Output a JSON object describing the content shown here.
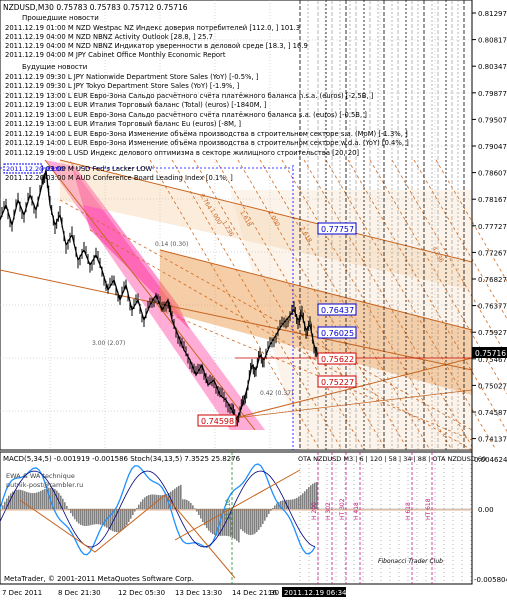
{
  "chart_header": "NZDUSD,M30  0.75783 0.75783 0.75712 0.75716",
  "news_past_title": "Прошедшие новости",
  "news_future_title": "Будущие новости",
  "news": [
    "2011.12.19 01:00 M NZD Westpac NZ Индекс доверия потребителей [112.0, ] 101.3",
    "2011.12.19 04:00 M NZD NBNZ Activity Outlook [28.8, ] 25.7",
    "2011.12.19 04:00 M NZD NBNZ Индикатор уверенности в деловой среде [18.3, ] 16.9",
    "2011.12.19 04:00 M JPY Cabinet Office Monthly Economic Report",
    "2011.12.19 09:30 L JPY Nationwide Department Store Sales (YoY) [-0.5%, ]",
    "2011.12.19 09:30 L JPY Tokyo Department Store Sales (YoY) [-1.9%, ]",
    "2011.12.19 13:00 L EUR Евро-Зона Сальдо расчётного счёта платёжного баланса n.s.a. (euros) [-2.5B, ]",
    "2011.12.19 13:00 L EUR Италия Торговый баланс (Total) (euros) [-1840M, ]",
    "2011.12.19 13:00 L EUR Евро-Зона Сальдо расчётного счёта платёжного баланса s.a. (euros) [-0.5B, ]",
    "2011.12.19 13:00 L EUR Италия Торговый баланс Eu (euros) [-8M, ]",
    "2011.12.19 14:00 L EUR Евро-Зона Изменение объёма производства в строительном секторе s.a. (MoM) [-1.3%, ]",
    "2011.12.19 14:00 L EUR Евро-Зона Изменение объёма производства в строительном секторе w.d.a. (YoY) [0.4%, ]",
    "2011.12.19 19:00 L USD Индекс делового оптимизма в секторе жилищного строительства [20, 20]",
    "2011.12.20 03:00 M USD Fed's Lacker LOW",
    "2011.12.20 03:00 M AUD Conference Board Leading Index [0.1%, ]"
  ],
  "news_time_box": "2011.12.20 03:00",
  "price_axis": [
    "0.81297",
    "0.80817",
    "0.80347",
    "0.79877",
    "0.79507",
    "0.79047",
    "0.78607",
    "0.78167",
    "0.77727",
    "0.77267",
    "0.76827",
    "0.76377",
    "0.75927",
    "0.75467",
    "0.75027",
    "0.74587",
    "0.74137"
  ],
  "price_labels": {
    "p1": "0.77757",
    "p2": "0.76437",
    "p3": "0.76025",
    "p4": "0.75622",
    "p5": "0.75227",
    "p6": "0.74598",
    "current": "0.75716"
  },
  "fib_labels": [
    {
      "text": "0.14 (0.30)"
    },
    {
      "text": "3.00 (2.07)"
    },
    {
      "text": "0.42 (0.37)"
    }
  ],
  "fan_labels": [
    "1.618",
    "2.000",
    "2.618",
    "4.236",
    "0.764",
    "1.000",
    "1.236"
  ],
  "indicator_header": "MACD(5,34,5) -0.001919 -0.001586  Stoch(34,13,5) 7.3525 25.8276",
  "indicator_tags": "OTA NZDUSD M3 | 6 | 120 | 58 | 34 | 88 | OTA NZDUSD 60",
  "watermark_lines": [
    "EWA & WA technique",
    "putnik-post@rambler.ru"
  ],
  "indicator_axis": [
    "0.004624",
    "0.00",
    "-0.005804"
  ],
  "cycle_labels": [
    "11 110",
    "H 200",
    "H 302",
    "HT 302",
    "H 418",
    "H 618",
    "HT 618"
  ],
  "signature": "Fibonacci Trader Club",
  "copyright": "MetaTrader, © 2001-2011 MetaQuotes Software Corp.",
  "time_axis": [
    "7 Dec 2011",
    "8 Dec 21:30",
    "12 Dec 05:30",
    "13 Dec 13:30",
    "14 Dec 21:30",
    "16"
  ],
  "time_axis_highlight": "2011.12.19 06:34",
  "colors": {
    "candle": "#000000",
    "blue_label": "#0000cc",
    "red_label": "#cc0000",
    "pink_band": "#ff1493",
    "orange_band": "#e8903a",
    "fib_lines": "#d2691e"
  }
}
